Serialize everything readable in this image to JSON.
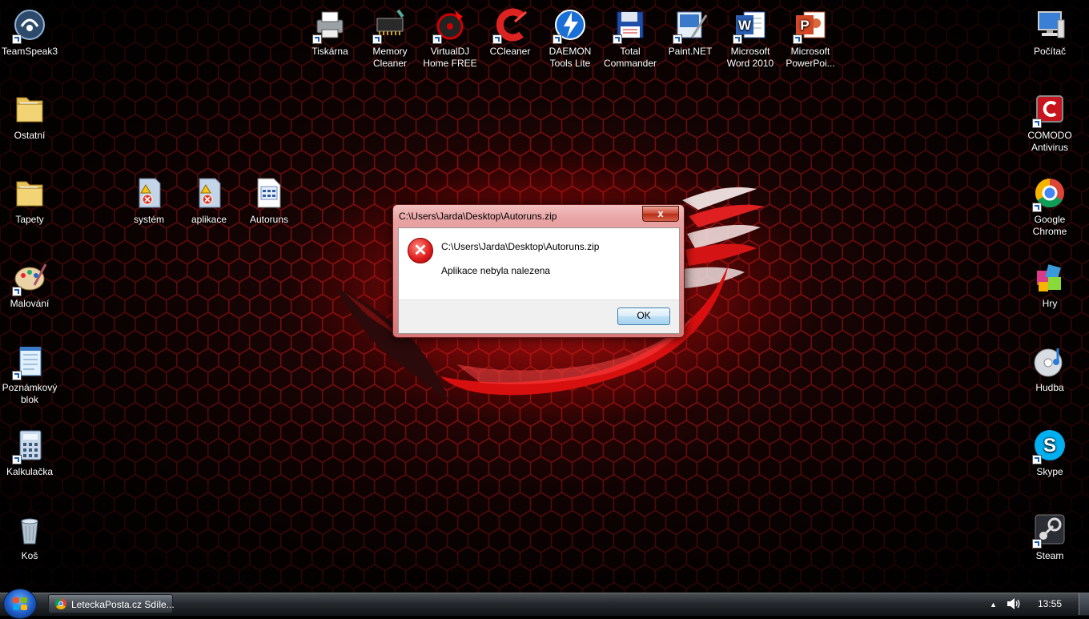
{
  "desktop": {
    "icons_left": [
      {
        "id": "teamspeak",
        "label": "TeamSpeak3",
        "shortcut": true,
        "icon": "teamspeak-icon"
      },
      {
        "id": "ostatni",
        "label": "Ostatní",
        "shortcut": false,
        "icon": "folder-icon"
      },
      {
        "id": "tapety",
        "label": "Tapety",
        "shortcut": false,
        "icon": "folder-icon"
      },
      {
        "id": "malovani",
        "label": "Malování",
        "shortcut": true,
        "icon": "paint-palette-icon"
      },
      {
        "id": "poznamkovy-blok",
        "label": "Poznámkový blok",
        "shortcut": true,
        "icon": "notepad-icon"
      },
      {
        "id": "kalkulacka",
        "label": "Kalkulačka",
        "shortcut": true,
        "icon": "calculator-icon"
      },
      {
        "id": "kos",
        "label": "Koš",
        "shortcut": false,
        "icon": "recycle-bin-icon"
      }
    ],
    "icons_top": [
      {
        "id": "tiskarna",
        "label": "Tiskárna",
        "shortcut": true,
        "icon": "printer-icon"
      },
      {
        "id": "memory-cleaner",
        "label": "Memory Cleaner",
        "shortcut": true,
        "icon": "memory-chip-icon"
      },
      {
        "id": "virtualdj",
        "label": "VirtualDJ Home FREE",
        "shortcut": true,
        "icon": "virtualdj-icon"
      },
      {
        "id": "ccleaner",
        "label": "CCleaner",
        "shortcut": true,
        "icon": "ccleaner-icon"
      },
      {
        "id": "daemon-tools",
        "label": "DAEMON Tools Lite",
        "shortcut": true,
        "icon": "daemon-tools-icon"
      },
      {
        "id": "total-commander",
        "label": "Total Commander",
        "shortcut": true,
        "icon": "floppy-disk-icon"
      },
      {
        "id": "paint-net",
        "label": "Paint.NET",
        "shortcut": true,
        "icon": "paint-net-icon"
      },
      {
        "id": "word-2010",
        "label": "Microsoft Word 2010",
        "shortcut": true,
        "icon": "word-icon"
      },
      {
        "id": "powerpoint",
        "label": "Microsoft PowerPoi...",
        "shortcut": true,
        "icon": "powerpoint-icon"
      }
    ],
    "icons_middle": [
      {
        "id": "system",
        "label": "systém",
        "shortcut": false,
        "icon": "warning-document-icon"
      },
      {
        "id": "aplikace",
        "label": "aplikace",
        "shortcut": false,
        "icon": "warning-document-icon"
      },
      {
        "id": "autoruns",
        "label": "Autoruns",
        "shortcut": false,
        "icon": "autoruns-file-icon"
      }
    ],
    "icons_right": [
      {
        "id": "pocitac",
        "label": "Počítač",
        "shortcut": false,
        "icon": "computer-icon"
      },
      {
        "id": "comodo",
        "label": "COMODO Antivirus",
        "shortcut": true,
        "icon": "comodo-icon"
      },
      {
        "id": "google-chrome",
        "label": "Google Chrome",
        "shortcut": true,
        "icon": "chrome-icon"
      },
      {
        "id": "hry",
        "label": "Hry",
        "shortcut": false,
        "icon": "games-icon"
      },
      {
        "id": "hudba",
        "label": "Hudba",
        "shortcut": false,
        "icon": "music-cd-icon"
      },
      {
        "id": "skype",
        "label": "Skype",
        "shortcut": true,
        "icon": "skype-icon"
      },
      {
        "id": "steam",
        "label": "Steam",
        "shortcut": true,
        "icon": "steam-icon"
      }
    ]
  },
  "dialog": {
    "title": "C:\\Users\\Jarda\\Desktop\\Autoruns.zip",
    "close_label": "x",
    "path": "C:\\Users\\Jarda\\Desktop\\Autoruns.zip",
    "message": "Aplikace nebyla nalezena",
    "ok_label": "OK",
    "error_glyph": "✕"
  },
  "taskbar": {
    "window_label": "LeteckaPosta.cz Sdíle...",
    "clock": "13:55",
    "tray_arrow": "▲"
  },
  "colors": {
    "hex_line": "#c81a1a",
    "logo_red": "#d80f0f",
    "logo_white": "#f4eded"
  }
}
